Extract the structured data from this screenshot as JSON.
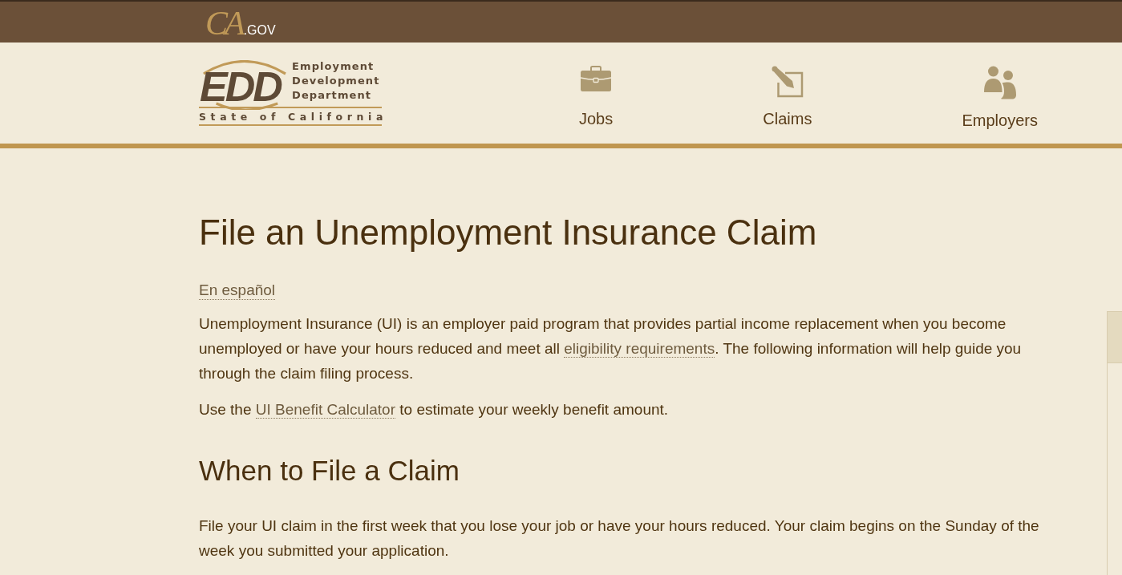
{
  "top_bar": {
    "logo_mark": "CA",
    "logo_suffix": ".GOV"
  },
  "header": {
    "logo": {
      "mark": "EDD",
      "lines": [
        "Employment",
        "Development",
        "Department"
      ],
      "tagline": "State of California"
    },
    "nav": [
      {
        "label": "Jobs"
      },
      {
        "label": "Claims"
      },
      {
        "label": "Employers"
      }
    ]
  },
  "main": {
    "title": "File an Unemployment Insurance Claim",
    "language_link": "En español",
    "blocks": [
      {
        "kind": "paragraph",
        "parts": [
          {
            "kind": "text",
            "text": "Unemployment Insurance (UI) is an employer paid program that provides partial income replacement when you become unemployed or have your hours reduced and meet all "
          },
          {
            "kind": "link",
            "text": "eligibility requirements"
          },
          {
            "kind": "text",
            "text": ". The following information will help guide you through the claim filing process."
          }
        ]
      },
      {
        "kind": "paragraph",
        "parts": [
          {
            "kind": "text",
            "text": "Use the "
          },
          {
            "kind": "link",
            "text": "UI Benefit Calculator"
          },
          {
            "kind": "text",
            "text": " to estimate your weekly benefit amount."
          }
        ]
      },
      {
        "kind": "heading",
        "text": "When to File a Claim"
      },
      {
        "kind": "paragraph",
        "parts": [
          {
            "kind": "text",
            "text": "File your UI claim in the first week that you lose your job or have your hours reduced. Your claim begins on the Sunday of the week you submitted your application."
          }
        ]
      }
    ]
  }
}
